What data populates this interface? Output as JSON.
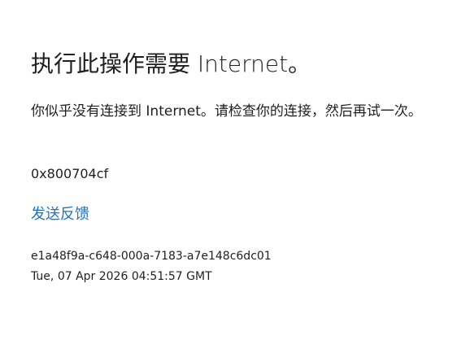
{
  "error_page": {
    "title": "执行此操作需要 Internet。",
    "message": "你似乎没有连接到 Internet。请检查你的连接，然后再试一次。",
    "error_code": "0x800704cf",
    "feedback_link": "发送反馈",
    "correlation_id": "e1a48f9a-c648-000a-7183-a7e148c6dc01",
    "timestamp": "Tue, 07 Apr 2026 04:51:57 GMT"
  },
  "colors": {
    "link": "#1a73c8",
    "text": "#1f1f1f",
    "background": "#ffffff"
  }
}
